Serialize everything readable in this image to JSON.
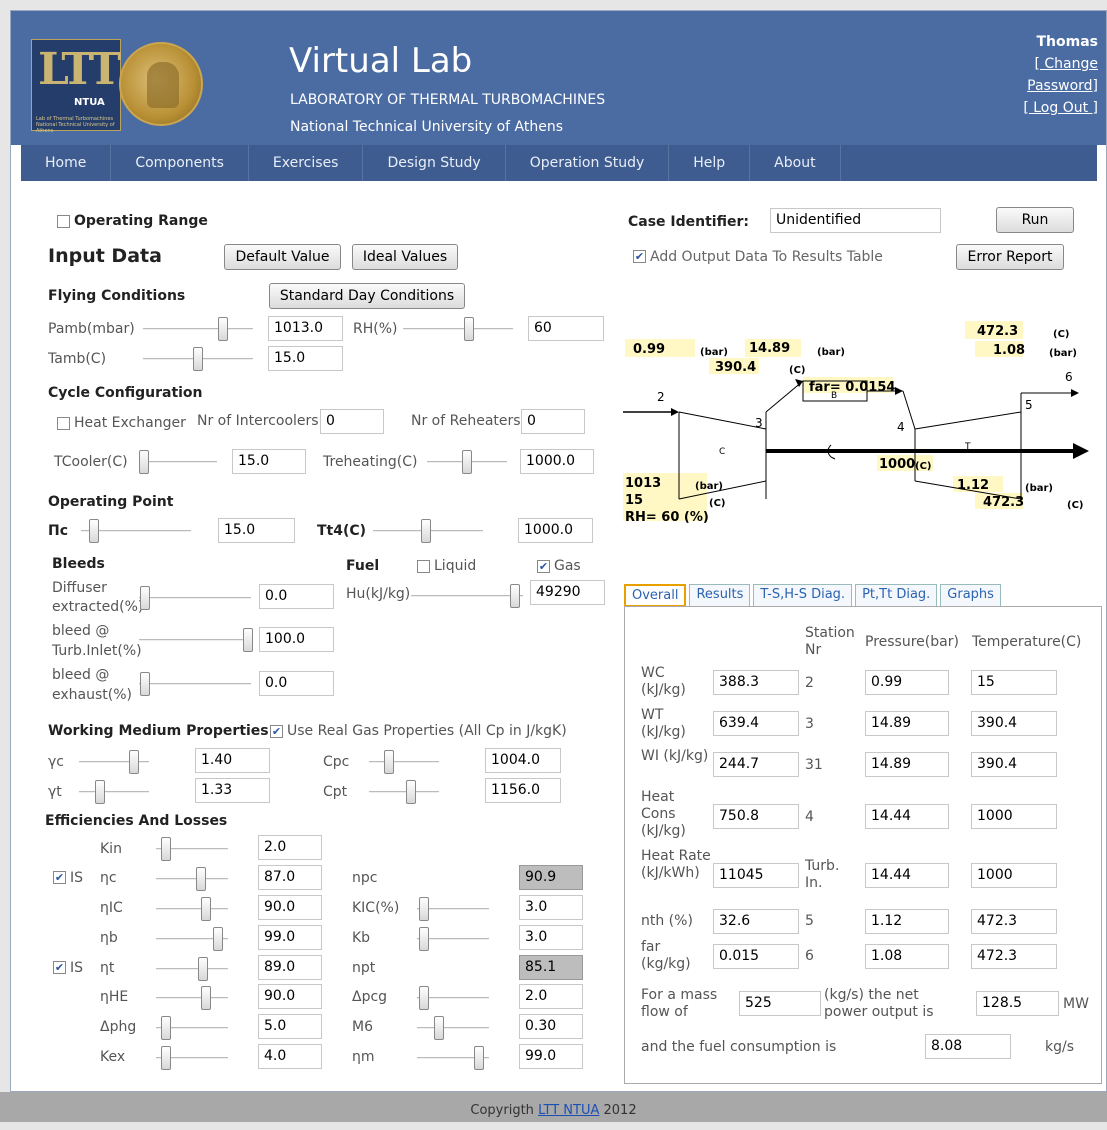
{
  "header": {
    "title": "Virtual Lab",
    "subtitle1": "LABORATORY OF THERMAL TURBOMACHINES",
    "subtitle2": "National Technical University of Athens",
    "logo_text": "LTT",
    "logo_ntua": "NTUA",
    "logo_small": "Lab of Thermal Turbomachines National Technical University of Athens",
    "user": "Thomas",
    "change_password_1": "[ Change",
    "change_password_2": "Password]",
    "logout": "[ Log Out ]"
  },
  "nav": [
    "Home",
    "Components",
    "Exercises",
    "Design Study",
    "Operation Study",
    "Help",
    "About"
  ],
  "left": {
    "operating_range": "Operating Range",
    "input_data": "Input Data",
    "default_value_btn": "Default Value",
    "ideal_values_btn": "Ideal Values",
    "flying_conditions": "Flying Conditions",
    "standard_day_btn": "Standard Day Conditions",
    "pamb_label": "Pamb(mbar)",
    "pamb_value": "1013.0",
    "rh_label": "RH(%)",
    "rh_value": "60",
    "tamb_label": "Tamb(C)",
    "tamb_value": "15.0",
    "cycle_configuration": "Cycle Configuration",
    "heat_exchanger": "Heat Exchanger",
    "nr_intercoolers_label": "Nr of Intercoolers",
    "nr_intercoolers_value": "0",
    "nr_reheaters_label": "Nr of Reheaters",
    "nr_reheaters_value": "0",
    "tcooler_label": "TCooler(C)",
    "tcooler_value": "15.0",
    "treheating_label": "Treheating(C)",
    "treheating_value": "1000.0",
    "operating_point": "Operating Point",
    "pic_label": "Πc",
    "pic_value": "15.0",
    "tt4_label": "Tt4(C)",
    "tt4_value": "1000.0",
    "bleeds": "Bleeds",
    "diffuser_label_1": "Diffuser",
    "diffuser_label_2": "extracted(%)",
    "diffuser_value": "0.0",
    "bleed_turb_1": "bleed @",
    "bleed_turb_2": "Turb.Inlet(%)",
    "bleed_turb_value": "100.0",
    "bleed_exh_1": "bleed @",
    "bleed_exh_2": "exhaust(%)",
    "bleed_exh_value": "0.0",
    "fuel": "Fuel",
    "liquid": "Liquid",
    "gas": "Gas",
    "hu_label": "Hu(kJ/kg)",
    "hu_value": "49290",
    "working_medium": "Working Medium Properties",
    "use_real_gas": "Use Real Gas Properties (All Cp in J/kgK)",
    "gc_label": "γc",
    "gc_value": "1.40",
    "cpc_label": "Cpc",
    "cpc_value": "1004.0",
    "gt_label": "γt",
    "gt_value": "1.33",
    "cpt_label": "Cpt",
    "cpt_value": "1156.0",
    "efficiencies": "Efficiencies And Losses",
    "is_label": "IS",
    "kin_label": "Kin",
    "kin_value": "2.0",
    "nc_label": "ηc",
    "nc_value": "87.0",
    "npc_label": "npc",
    "npc_value": "90.9",
    "nic_label": "ηIC",
    "nic_value": "90.0",
    "kic_label": "KIC(%)",
    "kic_value": "3.0",
    "nb_label": "ηb",
    "nb_value": "99.0",
    "kb_label": "Kb",
    "kb_value": "3.0",
    "nt_label": "ηt",
    "nt_value": "89.0",
    "npt_label": "npt",
    "npt_value": "85.1",
    "nhe_label": "ηHE",
    "nhe_value": "90.0",
    "dpcg_label": "Δpcg",
    "dpcg_value": "2.0",
    "dphg_label": "Δphg",
    "dphg_value": "5.0",
    "m6_label": "M6",
    "m6_value": "0.30",
    "kex_label": "Kex",
    "kex_value": "4.0",
    "nm_label": "ηm",
    "nm_value": "99.0"
  },
  "right": {
    "case_identifier_label": "Case Identifier:",
    "case_identifier_value": "Unidentified",
    "run_btn": "Run",
    "add_output": "Add Output Data To Results Table",
    "error_report_btn": "Error Report",
    "diagram": {
      "p2": "0.99",
      "p2u": "(bar)",
      "p3": "14.89",
      "p3u": "(bar)",
      "t3": "390.4",
      "t3u": "(C)",
      "t5": "472.3",
      "t5u": "(C)",
      "p5": "1.08",
      "p5u": "(bar)",
      "far": "far= 0.0154",
      "s2": "2",
      "s3": "3",
      "s4": "4",
      "s5": "5",
      "s6": "6",
      "b": "B",
      "c": "C",
      "t": "T",
      "tt4": "1000",
      "tt4u": "(C)",
      "pamb": "1013",
      "pambu": "(bar)",
      "tamb": "15",
      "tambu": "(C)",
      "rh": "RH= 60 (%)",
      "p_out": "1.12",
      "p_outu": "(bar)",
      "t_out": "472.3",
      "t_outu": "(C)"
    },
    "tabs": [
      "Overall",
      "Results",
      "T-S,H-S Diag.",
      "Pt,Tt Diag.",
      "Graphs"
    ],
    "table": {
      "station_hdr": "Station Nr",
      "pressure_hdr": "Pressure(bar)",
      "temperature_hdr": "Temperature(C)",
      "rows": [
        {
          "label": "WC (kJ/kg)",
          "value": "388.3",
          "station": "2",
          "p": "0.99",
          "t": "15"
        },
        {
          "label": "WT (kJ/kg)",
          "value": "639.4",
          "station": "3",
          "p": "14.89",
          "t": "390.4"
        },
        {
          "label": "WI (kJ/kg)",
          "value": "244.7",
          "station": "31",
          "p": "14.89",
          "t": "390.4"
        },
        {
          "label": "Heat Cons (kJ/kg)",
          "value": "750.8",
          "station": "4",
          "p": "14.44",
          "t": "1000"
        },
        {
          "label": "Heat Rate (kJ/kWh)",
          "value": "11045",
          "station": "Turb. In.",
          "p": "14.44",
          "t": "1000"
        },
        {
          "label": "nth (%)",
          "value": "32.6",
          "station": "5",
          "p": "1.12",
          "t": "472.3"
        },
        {
          "label": "far (kg/kg)",
          "value": "0.015",
          "station": "6",
          "p": "1.08",
          "t": "472.3"
        }
      ],
      "mass_flow_label": "For a mass flow of",
      "mass_flow_value": "525",
      "net_power_label": "(kg/s) the net power output is",
      "net_power_value": "128.5",
      "net_power_unit": "MW",
      "fuel_cons_label": "and the fuel consumption is",
      "fuel_cons_value": "8.08",
      "fuel_cons_unit": "kg/s"
    }
  },
  "footer": {
    "text": "Copyrigth",
    "link": "LTT NTUA",
    "year": "2012"
  },
  "colors": {
    "header": "#4b6ca3",
    "nav": "#3e5c8f",
    "highlight": "#fff8c4",
    "npc_bg": "#bdbdbd"
  }
}
